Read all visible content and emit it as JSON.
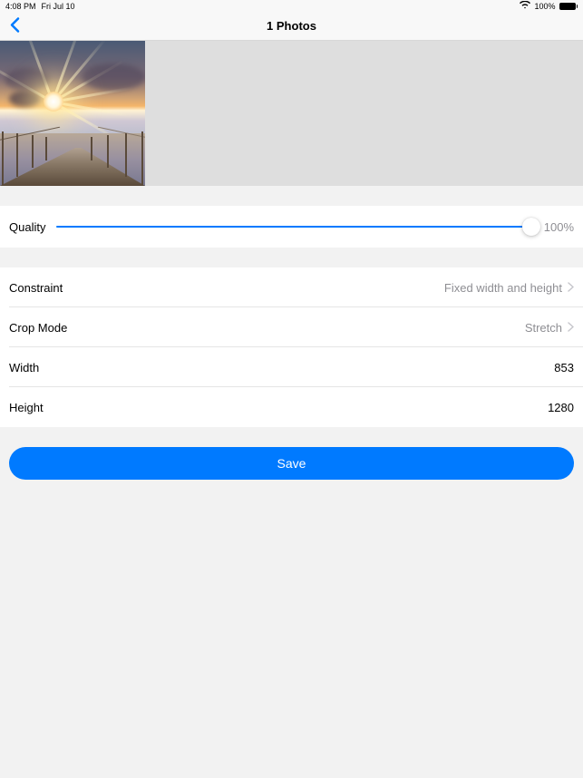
{
  "status": {
    "time": "4:08 PM",
    "date": "Fri Jul 10",
    "battery_pct": "100%"
  },
  "nav": {
    "title": "1 Photos"
  },
  "quality": {
    "label": "Quality",
    "value": "100%"
  },
  "rows": {
    "constraint_label": "Constraint",
    "constraint_value": "Fixed width and height",
    "crop_mode_label": "Crop Mode",
    "crop_mode_value": "Stretch",
    "width_label": "Width",
    "width_value": "853",
    "height_label": "Height",
    "height_value": "1280"
  },
  "buttons": {
    "save": "Save"
  }
}
